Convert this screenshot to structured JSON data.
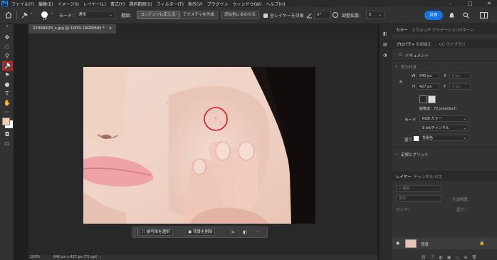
{
  "menubar": {
    "logo": "Ps",
    "items": [
      "ファイル(F)",
      "編集(E)",
      "イメージ(I)",
      "レイヤー(L)",
      "書式(Y)",
      "選択範囲(S)",
      "フィルター(T)",
      "表示(V)",
      "プラグイン",
      "ウィンドウ(W)",
      "ヘルプ(H)"
    ],
    "window_controls": {
      "minimize": "–",
      "restore": "□",
      "close": "✕"
    }
  },
  "options": {
    "brush_size": "19",
    "mode_label": "モード：",
    "mode_value": "通常",
    "type_label": "種類：",
    "type_content_aware": "コンテンツに応じる",
    "type_texture": "テクスチャを作成",
    "type_proximity": "近似色に合わせる",
    "sample_all_layers": "全レイヤーを対象",
    "angle_value": "0°",
    "diffusion_label": "調整拡散：",
    "diffusion_value": "5",
    "share_label": "共有"
  },
  "document": {
    "tab_title": "22368429_s.jpg @ 100% (RGB/8#) *",
    "close_glyph": "×",
    "status_zoom": "100%",
    "status_info": "640 px x 427 px (72 ppi)"
  },
  "taskbar": {
    "select_subject": "被写体を選択",
    "remove_background": "背景を削除",
    "more": "···"
  },
  "panels": {
    "top_tabs": [
      "カラー",
      "スウォッチ",
      "グラデーション",
      "パターン"
    ],
    "prop_tabs": [
      "プロパティ",
      "色調補正",
      "CC ライブラリ"
    ],
    "doc_label": "ドキュメント",
    "canvas_header": "カンバス",
    "w_label": "W",
    "w_value": "640 px",
    "x_label": "X",
    "x_value": "0 px",
    "h_label": "H",
    "h_value": "427 px",
    "y_label": "Y",
    "y_value": "0 px",
    "resolution": "解像度：72 pixel/inch",
    "mode_label": "モード",
    "mode_value": "RGB カラー",
    "bit_value": "8 bit/チャンネル",
    "fill_label": "塗り",
    "fill_value": "背景色",
    "guides_header": "定規とグリッド",
    "layer_tabs": [
      "レイヤー",
      "チャンネル",
      "パス"
    ],
    "kind_label": "種類",
    "blend_label": "通常",
    "opacity_label": "不透明度：",
    "lock_label": "ロック：",
    "fill2_label": "塗り：",
    "layer_name": "背景"
  },
  "colors": {
    "accent": "#1473e6",
    "highlight_red": "#e01818",
    "foreground": "#f3d1b0",
    "background": "#ffffff"
  },
  "icons": [
    "home-icon",
    "brush-icon",
    "healing-brush-icon",
    "eye-icon",
    "lock-icon",
    "bell-icon",
    "search-icon"
  ]
}
